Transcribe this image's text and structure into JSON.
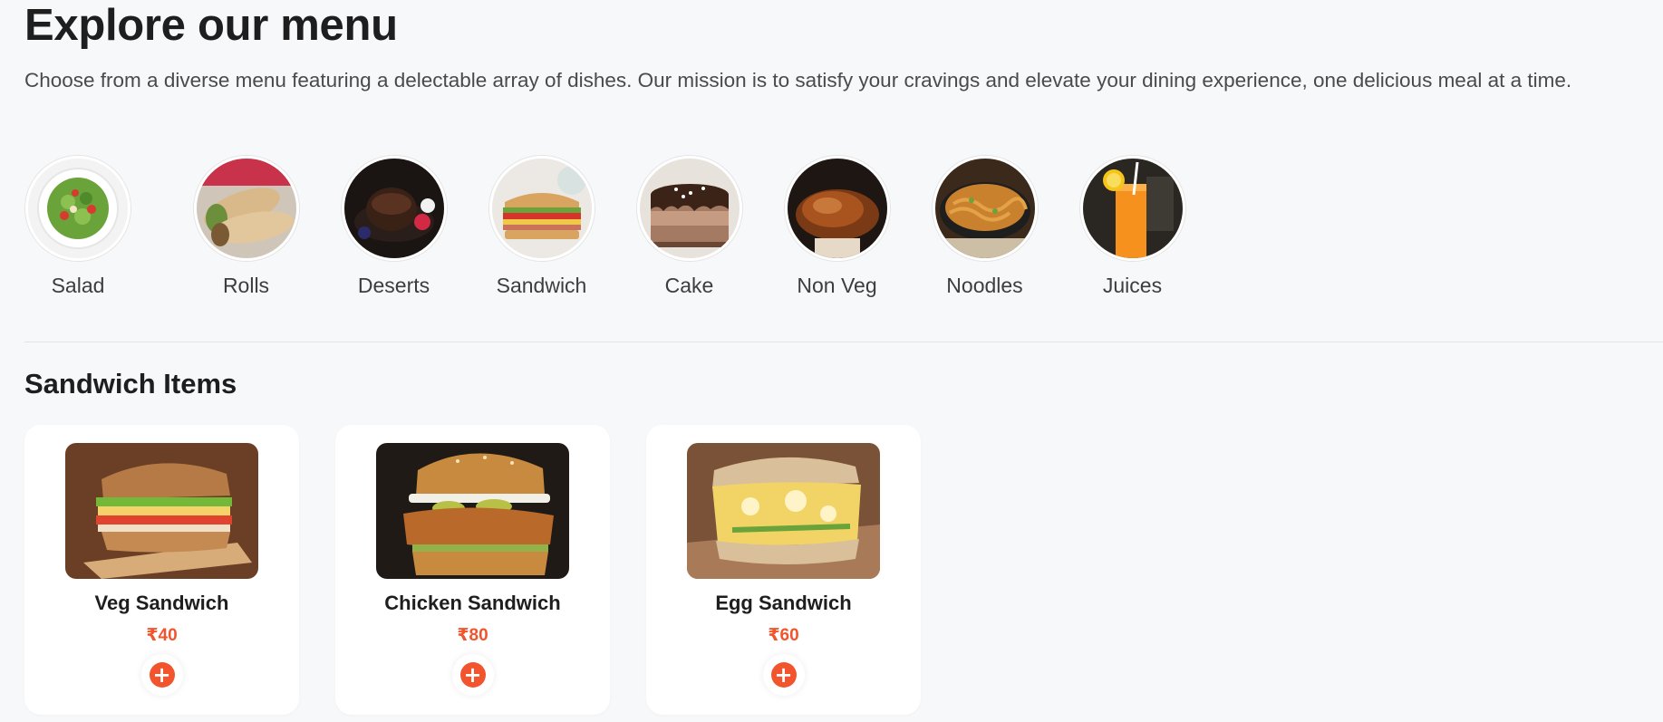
{
  "header": {
    "title": "Explore our menu",
    "subtitle": "Choose from a diverse menu featuring a delectable array of dishes. Our mission is to satisfy your cravings and elevate your dining experience, one delicious meal at a time."
  },
  "categories": [
    {
      "label": "Salad",
      "icon": "salad-image"
    },
    {
      "label": "Rolls",
      "icon": "rolls-image"
    },
    {
      "label": "Deserts",
      "icon": "deserts-image"
    },
    {
      "label": "Sandwich",
      "icon": "sandwich-image"
    },
    {
      "label": "Cake",
      "icon": "cake-image"
    },
    {
      "label": "Non Veg",
      "icon": "non-veg-image"
    },
    {
      "label": "Noodles",
      "icon": "noodles-image"
    },
    {
      "label": "Juices",
      "icon": "juices-image"
    }
  ],
  "section": {
    "title": "Sandwich Items"
  },
  "items": [
    {
      "name": "Veg Sandwich",
      "price": "₹40",
      "add_icon": "+"
    },
    {
      "name": "Chicken Sandwich",
      "price": "₹80",
      "add_icon": "+"
    },
    {
      "name": "Egg Sandwich",
      "price": "₹60",
      "add_icon": "+"
    }
  ],
  "colors": {
    "accent": "#f2542d",
    "background": "#f7f8fa",
    "card": "#ffffff"
  }
}
